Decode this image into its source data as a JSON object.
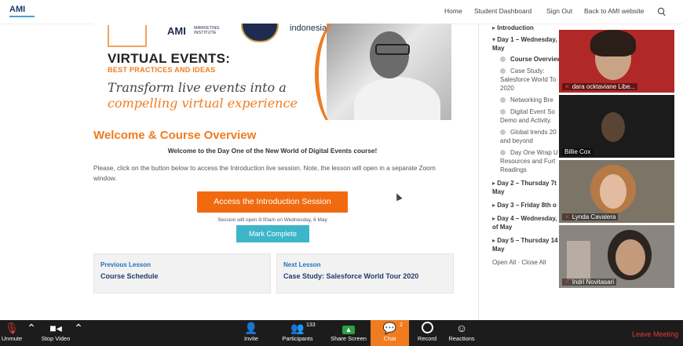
{
  "logo": {
    "text": "AMI"
  },
  "nav": {
    "home": "Home",
    "dashboard": "Student Dashboard",
    "signout": "Sign Out",
    "back": "Back to AMI website"
  },
  "banner": {
    "logo1": "AMI",
    "logo1_sub": "MARKETING INSTITUTE",
    "logo3": "indonesia",
    "title": "VIRTUAL EVENTS:",
    "subtitle": "BEST PRACTICES AND IDEAS",
    "line1": "Transform live events into a",
    "line2": "compelling virtual experience"
  },
  "main": {
    "heading": "Welcome & Course Overview",
    "sub": "Welcome to the Day One of the New World of Digital Events course!",
    "para": "Please, click on the button below to access the Introduction live session. Note, the lesson will open in a separate Zoom window.",
    "access_btn": "Access the Introduction Session",
    "opens": "Session will open 9:00am on Wednesday, 6 May",
    "mark_btn": "Mark Complete",
    "prev_label": "Previous Lesson",
    "prev_title": "Course Schedule",
    "next_label": "Next Lesson",
    "next_title": "Case Study: Salesforce World Tour 2020"
  },
  "sidebar": {
    "intro": "Introduction",
    "day1": "Day 1 – Wednesday,",
    "day1b": "May",
    "l1": "Course Overview",
    "l2a": "Case Study:",
    "l2b": "Salesforce World To",
    "l2c": "2020",
    "l3": "Networking Bre",
    "l4a": "Digital Event So",
    "l4b": "Demo and Activity.",
    "l5a": "Global trends 20",
    "l5b": "and beyond",
    "l6a": "Day One Wrap U",
    "l6b": "Resources and Furt",
    "l6c": "Readings",
    "day2": "Day 2 – Thursday 7t",
    "day2b": "May",
    "day3": "Day 3 – Friday 8th o",
    "day4": "Day 4 – Wednesday,",
    "day4b": "of May",
    "day5": "Day 5 – Thursday 14",
    "day5b": "May",
    "open_close": "Open All · Close All"
  },
  "participants": [
    {
      "name": "dara ocktaviane Libe..."
    },
    {
      "name": "Billie Cox"
    },
    {
      "name": "Lynda Cavalera"
    },
    {
      "name": "Indri Novitasari"
    }
  ],
  "zoom": {
    "unmute": "Unmute",
    "stop_video": "Stop Video",
    "invite": "Invite",
    "participants": "Participants",
    "participants_count": "133",
    "share": "Share Screen",
    "chat": "Chat",
    "chat_count": "2",
    "record": "Record",
    "reactions": "Reactions",
    "leave": "Leave Meeting"
  }
}
